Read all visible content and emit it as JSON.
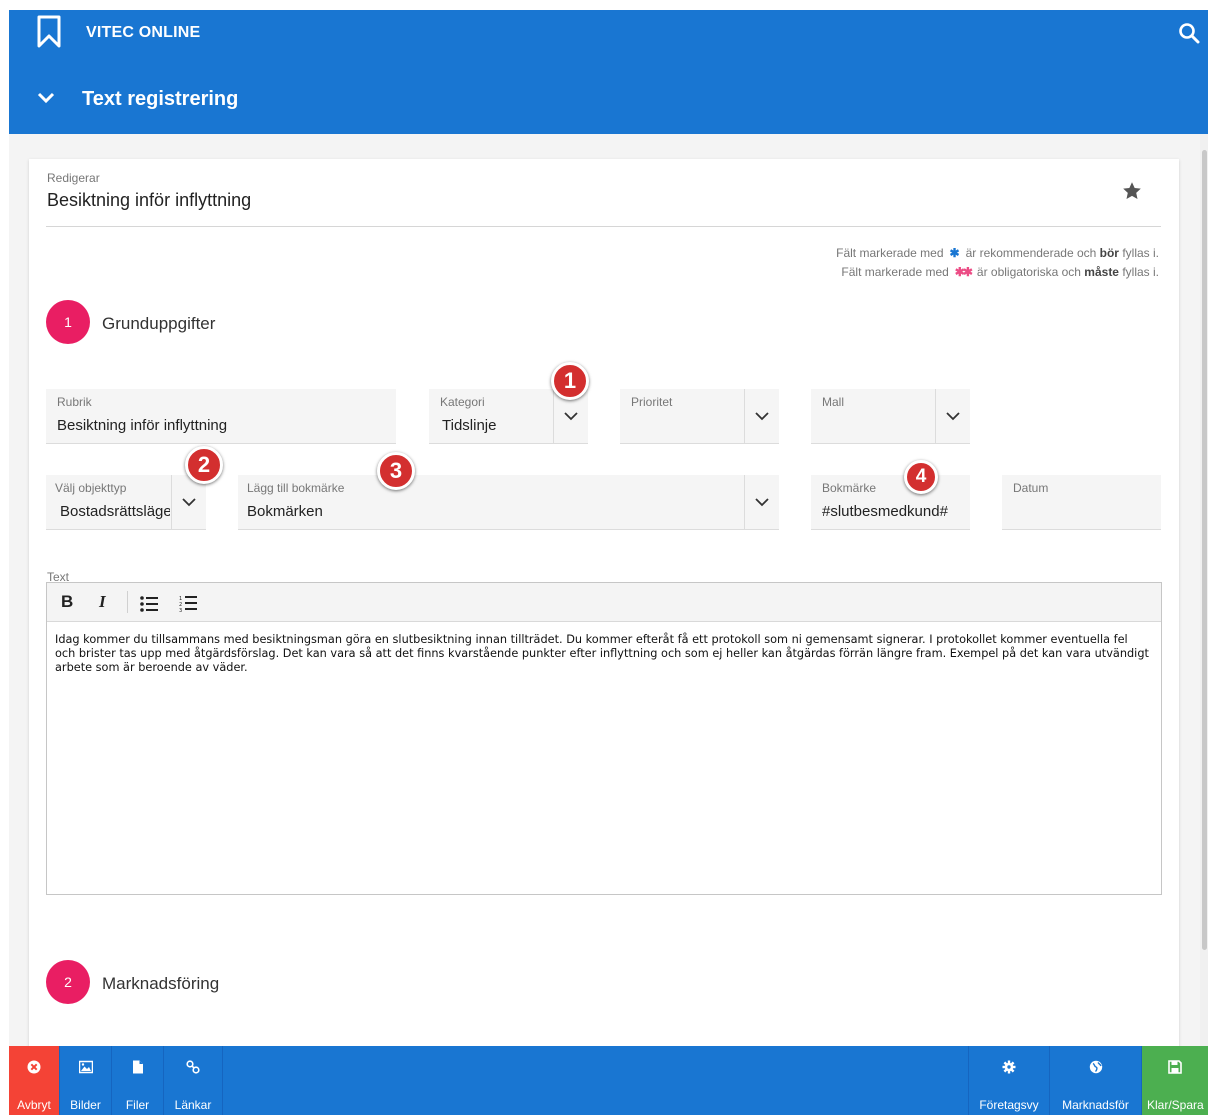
{
  "header": {
    "app_name": "VITEC ONLINE",
    "page_title": "Text registrering",
    "colors": {
      "bar": "#1976d2"
    }
  },
  "card": {
    "editing_label": "Redigerar",
    "doc_title": "Besiktning inför inflyttning"
  },
  "legend": {
    "line1_pre": "Fält markerade med",
    "line1_mark": "✱",
    "line1_post_a": "är rekommenderade och ",
    "line1_bold": "bör",
    "line1_post_b": " fyllas i.",
    "line2_pre": "Fält markerade med",
    "line2_mark": "✱✱",
    "line2_post_a": "är obligatoriska och ",
    "line2_bold": "måste",
    "line2_post_b": " fyllas i."
  },
  "sections": [
    {
      "number": "1",
      "title": "Grunduppgifter"
    },
    {
      "number": "2",
      "title": "Marknadsföring"
    }
  ],
  "fields": {
    "rubrik": {
      "label": "Rubrik",
      "value": "Besiktning inför inflyttning"
    },
    "kategori": {
      "label": "Kategori",
      "value": "Tidslinje"
    },
    "prioritet": {
      "label": "Prioritet",
      "value": ""
    },
    "mall": {
      "label": "Mall",
      "value": ""
    },
    "objekttyp": {
      "label": "Välj objekttyp",
      "value": "Bostadsrättslägenhet"
    },
    "bokmarke_add": {
      "label": "Lägg till bokmärke",
      "value": "Bokmärken"
    },
    "bokmarke": {
      "label": "Bokmärke",
      "value": "#slutbesmedkund#"
    },
    "datum": {
      "label": "Datum",
      "value": ""
    }
  },
  "annotations": [
    "1",
    "2",
    "3",
    "4"
  ],
  "editor": {
    "label": "Text",
    "toolbar": {
      "bold": "B",
      "italic": "I"
    },
    "content": "Idag kommer du tillsammans med besiktningsman göra en slutbesiktning innan tillträdet. Du kommer efteråt få ett protokoll som ni gemensamt signerar. I protokollet kommer eventuella fel och brister tas upp med åtgärdsförslag. Det kan vara så att det finns kvarstående punkter efter inflyttning och som ej heller kan åtgärdas förrän längre fram. Exempel på det kan vara utvändigt arbete som är beroende av väder."
  },
  "bottom_bar": {
    "left": [
      {
        "label": "Avbryt",
        "icon": "cancel-icon",
        "color": "#f44336"
      },
      {
        "label": "Bilder",
        "icon": "image-icon"
      },
      {
        "label": "Filer",
        "icon": "file-icon"
      },
      {
        "label": "Länkar",
        "icon": "link-icon"
      }
    ],
    "right": [
      {
        "label": "Företagsvy",
        "icon": "gear-icon"
      },
      {
        "label": "Marknadsför",
        "icon": "globe-icon"
      },
      {
        "label": "Klar/Spara",
        "icon": "save-icon",
        "color": "#4caf50"
      }
    ]
  }
}
